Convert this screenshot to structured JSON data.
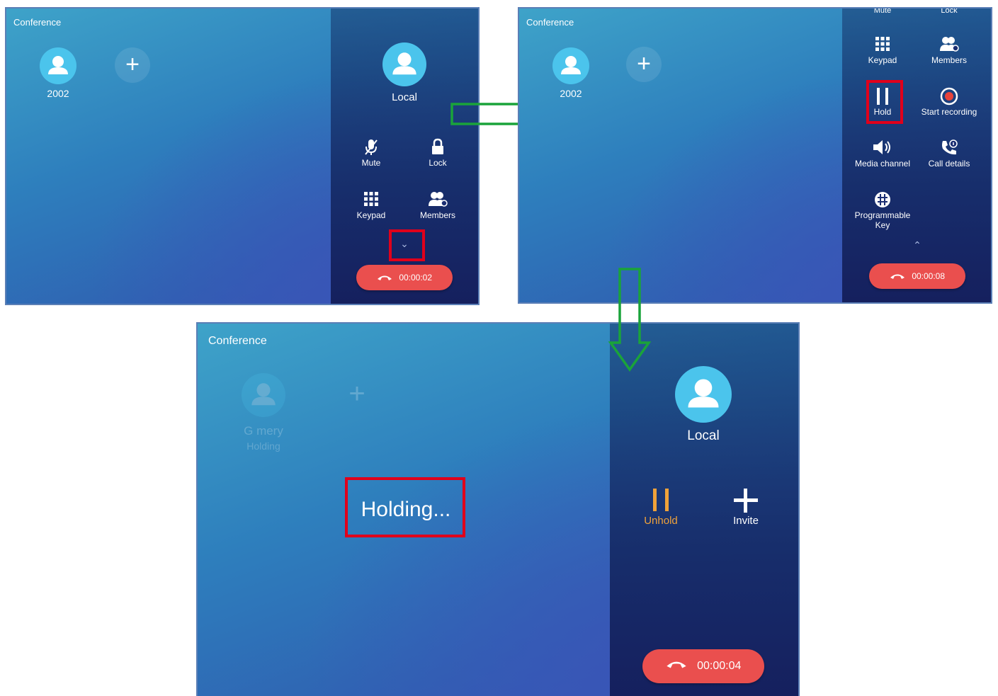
{
  "screens": {
    "s1": {
      "title": "Conference",
      "participant": {
        "label": "2002"
      },
      "local_label": "Local",
      "controls": {
        "mute": "Mute",
        "lock": "Lock",
        "keypad": "Keypad",
        "members": "Members"
      },
      "timer": "00:00:02"
    },
    "s2": {
      "title": "Conference",
      "participant": {
        "label": "2002"
      },
      "controls": {
        "mute": "Mute",
        "lock": "Lock",
        "keypad": "Keypad",
        "members": "Members",
        "hold": "Hold",
        "start_recording": "Start recording",
        "media_channel": "Media channel",
        "call_details": "Call details",
        "programmable_key_line1": "Programmable",
        "programmable_key_line2": "Key"
      },
      "timer": "00:00:08"
    },
    "s3": {
      "title": "Conference",
      "participant": {
        "label": "G mery",
        "status": "Holding"
      },
      "holding_text": "Holding...",
      "local_label": "Local",
      "controls": {
        "unhold": "Unhold",
        "invite": "Invite"
      },
      "timer": "00:00:04"
    }
  },
  "colors": {
    "end_call": "#ea4f4e",
    "highlight_box": "#e0001b",
    "flow_arrow": "#1aa33a",
    "unhold_accent": "#f0a23a",
    "avatar": "#4bc4ec"
  },
  "icons": [
    "person-icon",
    "plus-icon",
    "mic-off-icon",
    "lock-icon",
    "keypad-icon",
    "members-icon",
    "chevron-down-icon",
    "chevron-up-icon",
    "pause-icon",
    "record-icon",
    "speaker-icon",
    "call-details-icon",
    "grid-circle-icon",
    "phone-hangup-icon"
  ]
}
